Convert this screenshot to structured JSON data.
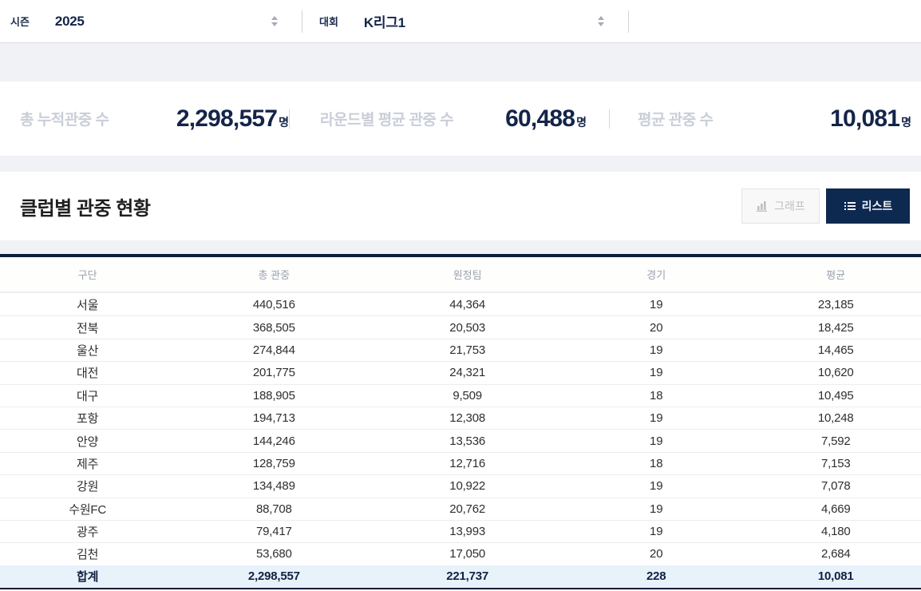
{
  "filters": {
    "season": {
      "label": "시즌",
      "value": "2025"
    },
    "competition": {
      "label": "대회",
      "value": "K리그1"
    }
  },
  "stats": [
    {
      "label": "총 누적관중 수",
      "value": "2,298,557",
      "unit": "명"
    },
    {
      "label": "라운드별 평균 관중 수",
      "value": "60,488",
      "unit": "명"
    },
    {
      "label": "평균 관중 수",
      "value": "10,081",
      "unit": "명"
    }
  ],
  "section": {
    "title": "클럽별 관중 현황",
    "graph_button_label": "그래프",
    "list_button_label": "리스트"
  },
  "table": {
    "headers": [
      "구단",
      "총 관중",
      "원정팀",
      "경기",
      "평균"
    ],
    "rows": [
      [
        "서울",
        "440,516",
        "44,364",
        "19",
        "23,185"
      ],
      [
        "전북",
        "368,505",
        "20,503",
        "20",
        "18,425"
      ],
      [
        "울산",
        "274,844",
        "21,753",
        "19",
        "14,465"
      ],
      [
        "대전",
        "201,775",
        "24,321",
        "19",
        "10,620"
      ],
      [
        "대구",
        "188,905",
        "9,509",
        "18",
        "10,495"
      ],
      [
        "포항",
        "194,713",
        "12,308",
        "19",
        "10,248"
      ],
      [
        "안양",
        "144,246",
        "13,536",
        "19",
        "7,592"
      ],
      [
        "제주",
        "128,759",
        "12,716",
        "18",
        "7,153"
      ],
      [
        "강원",
        "134,489",
        "10,922",
        "19",
        "7,078"
      ],
      [
        "수원FC",
        "88,708",
        "20,762",
        "19",
        "4,669"
      ],
      [
        "광주",
        "79,417",
        "13,993",
        "19",
        "4,180"
      ],
      [
        "김천",
        "53,680",
        "17,050",
        "20",
        "2,684"
      ]
    ],
    "total_row": [
      "합계",
      "2,298,557",
      "221,737",
      "228",
      "10,081"
    ]
  },
  "icons": {
    "season_select_arrows": "up-down-caret",
    "competition_select_arrows": "up-down-caret",
    "graph_button_icon": "bar-chart",
    "list_button_icon": "list-lines"
  },
  "colors": {
    "navy_accent": "#0e2950",
    "table_border_navy": "#0b1e3c",
    "stat_value_navy": "#14244a",
    "stat_label_gray": "#c9ced8",
    "band_gray": "#f1f2f5",
    "total_row_bg": "#e7f2fb"
  }
}
